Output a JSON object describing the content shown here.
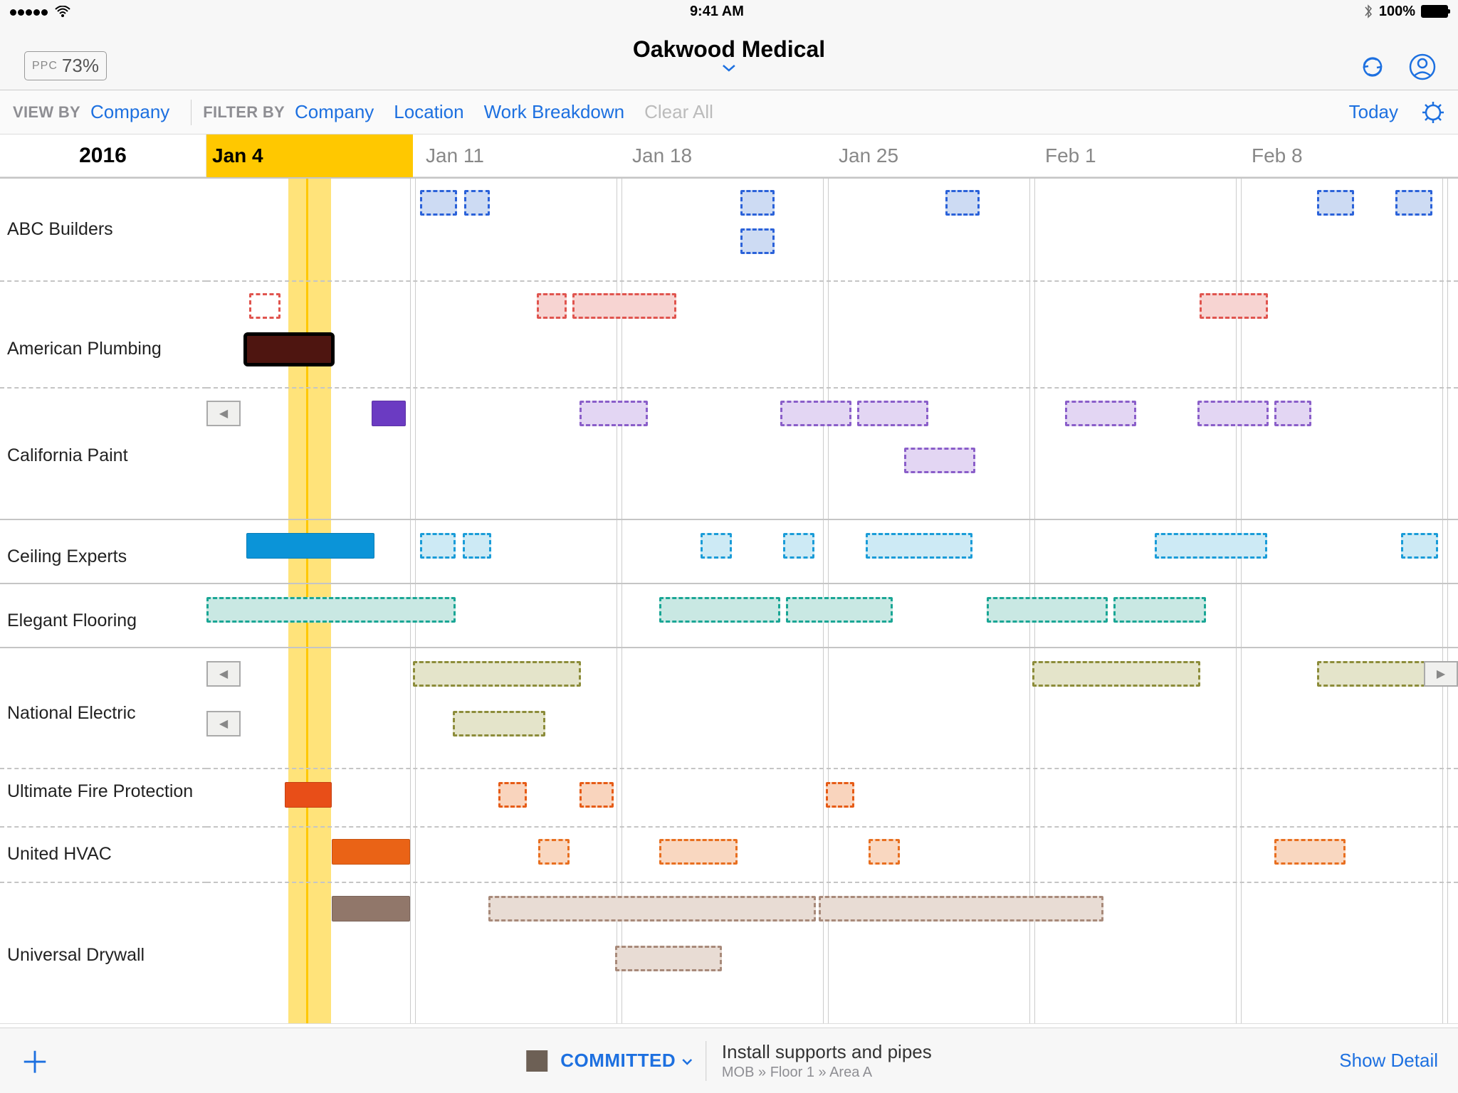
{
  "statusbar": {
    "time": "9:41 AM",
    "battery": "100%"
  },
  "header": {
    "ppc_label": "PPC",
    "ppc_value": "73%",
    "project_title": "Oakwood Medical"
  },
  "filterbar": {
    "view_by_label": "VIEW BY",
    "view_by_value": "Company",
    "filter_by_label": "FILTER BY",
    "filters": {
      "company": "Company",
      "location": "Location",
      "wbs": "Work Breakdown"
    },
    "clear_all": "Clear All",
    "today": "Today"
  },
  "timeline": {
    "year": "2016",
    "weeks": [
      "Jan 4",
      "Jan 11",
      "Jan 18",
      "Jan 25",
      "Feb 1",
      "Feb 8"
    ]
  },
  "rows": [
    {
      "name": "ABC Builders"
    },
    {
      "name": "American Plumbing"
    },
    {
      "name": "California Paint"
    },
    {
      "name": "Ceiling Experts"
    },
    {
      "name": "Elegant Flooring"
    },
    {
      "name": "National Electric"
    },
    {
      "name": "Ultimate Fire Protection"
    },
    {
      "name": "United HVAC"
    },
    {
      "name": "Universal Drywall"
    }
  ],
  "footer": {
    "status": "COMMITTED",
    "task_title": "Install supports and pipes",
    "task_path": "MOB » Floor 1 » Area A",
    "show_detail": "Show Detail"
  },
  "colors": {
    "abc": {
      "border": "#2b62d9",
      "fill": "#cddbf3"
    },
    "plumb": {
      "border": "#e0554f",
      "fill": "#f7d4d2"
    },
    "plumb_sel": "#4e1510",
    "paint": {
      "border": "#8a5ec9",
      "fill": "#e3d6f3"
    },
    "paint_solid": "#6b3bc2",
    "ceiling": {
      "border": "#1a9cd8",
      "fill": "#cdeaf5"
    },
    "ceiling_solid": "#0b94d8",
    "floor": {
      "border": "#1aa695",
      "fill": "#c9e8e3"
    },
    "electric": {
      "border": "#8c8c3a",
      "fill": "#e4e4ca"
    },
    "fire": {
      "border": "#e65c17",
      "fill": "#f9d4bd"
    },
    "fire_solid": "#e84e18",
    "hvac": {
      "border": "#e86f20",
      "fill": "#f9d7c0"
    },
    "hvac_solid": "#ea6316",
    "drywall": {
      "border": "#a88a7a",
      "fill": "#e8dcd4"
    },
    "drywall_solid": "#91776a"
  }
}
